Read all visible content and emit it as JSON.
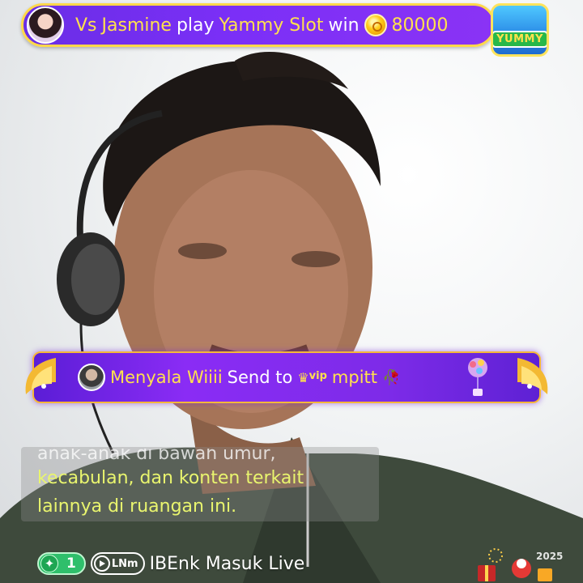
{
  "top_banner": {
    "vs": "Vs",
    "player": "Jasmine",
    "play_word": "play",
    "game": "Yammy Slot",
    "win_word": "win",
    "amount": "80000"
  },
  "logo": {
    "text": "YUMMY"
  },
  "gift_banner": {
    "sender": "Menyala Wiiii",
    "send_to": "Send to",
    "vip_label": "vip",
    "recipient": "mpitt"
  },
  "chat": {
    "line1": "anak-anak di bawah umur,",
    "line2": "kecabulan, dan konten terkait",
    "line3": "lainnya di ruangan ini."
  },
  "entry": {
    "level": "1",
    "badge": "LNm",
    "text": "IBEnk Masuk Live"
  },
  "corner_year": "2025",
  "icons": [
    "star-icon",
    "coin-icon",
    "crown-icon",
    "rose-icon",
    "balloon-gift-icon",
    "play-icon",
    "level-star-icon"
  ]
}
